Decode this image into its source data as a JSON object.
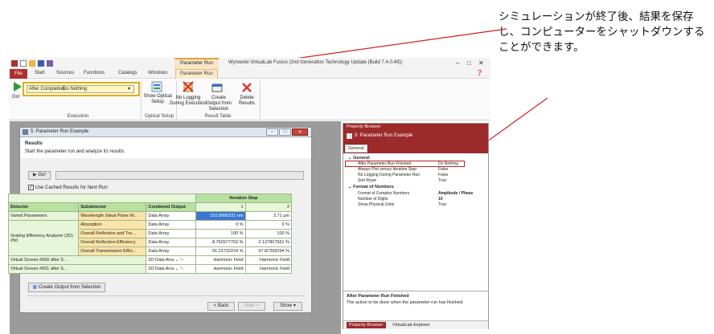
{
  "annotation": {
    "text": "シミュレーションが終了後、結果を保存し、コンピューターをシャットダウンすることができます。"
  },
  "app": {
    "title": "Wyrowski VirtualLab Fusion (2nd Generation Technology Update (Build 7.4.0.49))",
    "context_tab_header": "Parameter Run",
    "tabs": [
      "File",
      "Start",
      "Sources",
      "Functions",
      "Catalogs",
      "Windows",
      "Parameter Run"
    ],
    "ribbon": {
      "go_label": "Go!",
      "after_completion_label": "After Completion",
      "after_completion_value": "Do Nothing",
      "show_optical_setup_label": "Show Optical Setup",
      "no_logging_label": "No Logging During Execution",
      "create_output_label": "Create Output from Selection",
      "delete_results_label": "Delete Results",
      "groups": [
        "Execution",
        "Optical Setup",
        "Result Table"
      ]
    }
  },
  "dialog": {
    "title": "5: Parameter Run Example",
    "results_heading": "Results",
    "results_desc": "Start the parameter run and analyze its results.",
    "go_button": "Go!",
    "cached_checkbox": "Use Cached Results for Next Run",
    "iteration_step_header": "Iteration Step",
    "col_headers": [
      "Detector",
      "Subdetector",
      "Combined Output"
    ],
    "step_numbers": [
      "1",
      "2"
    ],
    "rows": [
      {
        "detector": "Varied Parameters",
        "sub": "Wavelength (Ideal Plane W...",
        "combined": "Data Array",
        "v1": "210.0606221 nm",
        "v2": "3.71 µm"
      },
      {
        "detector": "",
        "sub": "Absorption",
        "combined": "Data Array",
        "v1": "0 %",
        "v2": "0 %"
      },
      {
        "detector": "Grating Efficiency Analyzer (2D) #50",
        "sub": "Overall Reflection and Tra...",
        "combined": "Data Array",
        "v1": "100 %",
        "v2": "100 %"
      },
      {
        "detector": "",
        "sub": "Overall Reflection Efficiency",
        "combined": "Data Array",
        "v1": "8.762677763 %",
        "v2": "2.127807961 %"
      },
      {
        "detector": "",
        "sub": "Overall Transmission Effici...",
        "combined": "Data Array",
        "v1": "91.23732224 %",
        "v2": "97.87299294 %"
      },
      {
        "detector": "Virtual Screen #600 after S...",
        "sub": "",
        "combined": "2D Data Arra",
        "v1": "Harmonic Field",
        "v2": "Harmonic Field"
      },
      {
        "detector": "Virtual Screen #601 after S...",
        "sub": "",
        "combined": "2D Data Arra",
        "v1": "Harmonic Field",
        "v2": "Harmonic Field"
      }
    ],
    "create_output_button": "Create Output from Selection",
    "back_button": "< Back",
    "next_button": "Next >",
    "show_button": "Show ▾"
  },
  "property_browser": {
    "title": "Property Browser",
    "object": "5: Parameter Run Example",
    "tab": "General",
    "categories": [
      {
        "name": "General",
        "items": [
          {
            "k": "After Parameter Run Finished",
            "v": "Do Nothing"
          },
          {
            "k": "Always Plot versus Iteration Step",
            "v": "False"
          },
          {
            "k": "No Logging During Parameter Run",
            "v": "False"
          },
          {
            "k": "Sort Rows",
            "v": "True"
          }
        ]
      },
      {
        "name": "Format of Numbers",
        "items": [
          {
            "k": "Format of Complex Numbers",
            "v": "Amplitude / Phase"
          },
          {
            "k": "Number of Digits",
            "v": "10"
          },
          {
            "k": "Show Physical Units",
            "v": "True"
          }
        ]
      }
    ],
    "desc_title": "After Parameter Run Finished",
    "desc_text": "The action to be done when the parameter run has finished.",
    "bottom_tabs": [
      "Property Browser",
      "VirtualLab Explorer"
    ]
  },
  "colors": {
    "accent": "#9d2a2a",
    "highlight": "#e0b000",
    "arrow": "#cc2222"
  }
}
